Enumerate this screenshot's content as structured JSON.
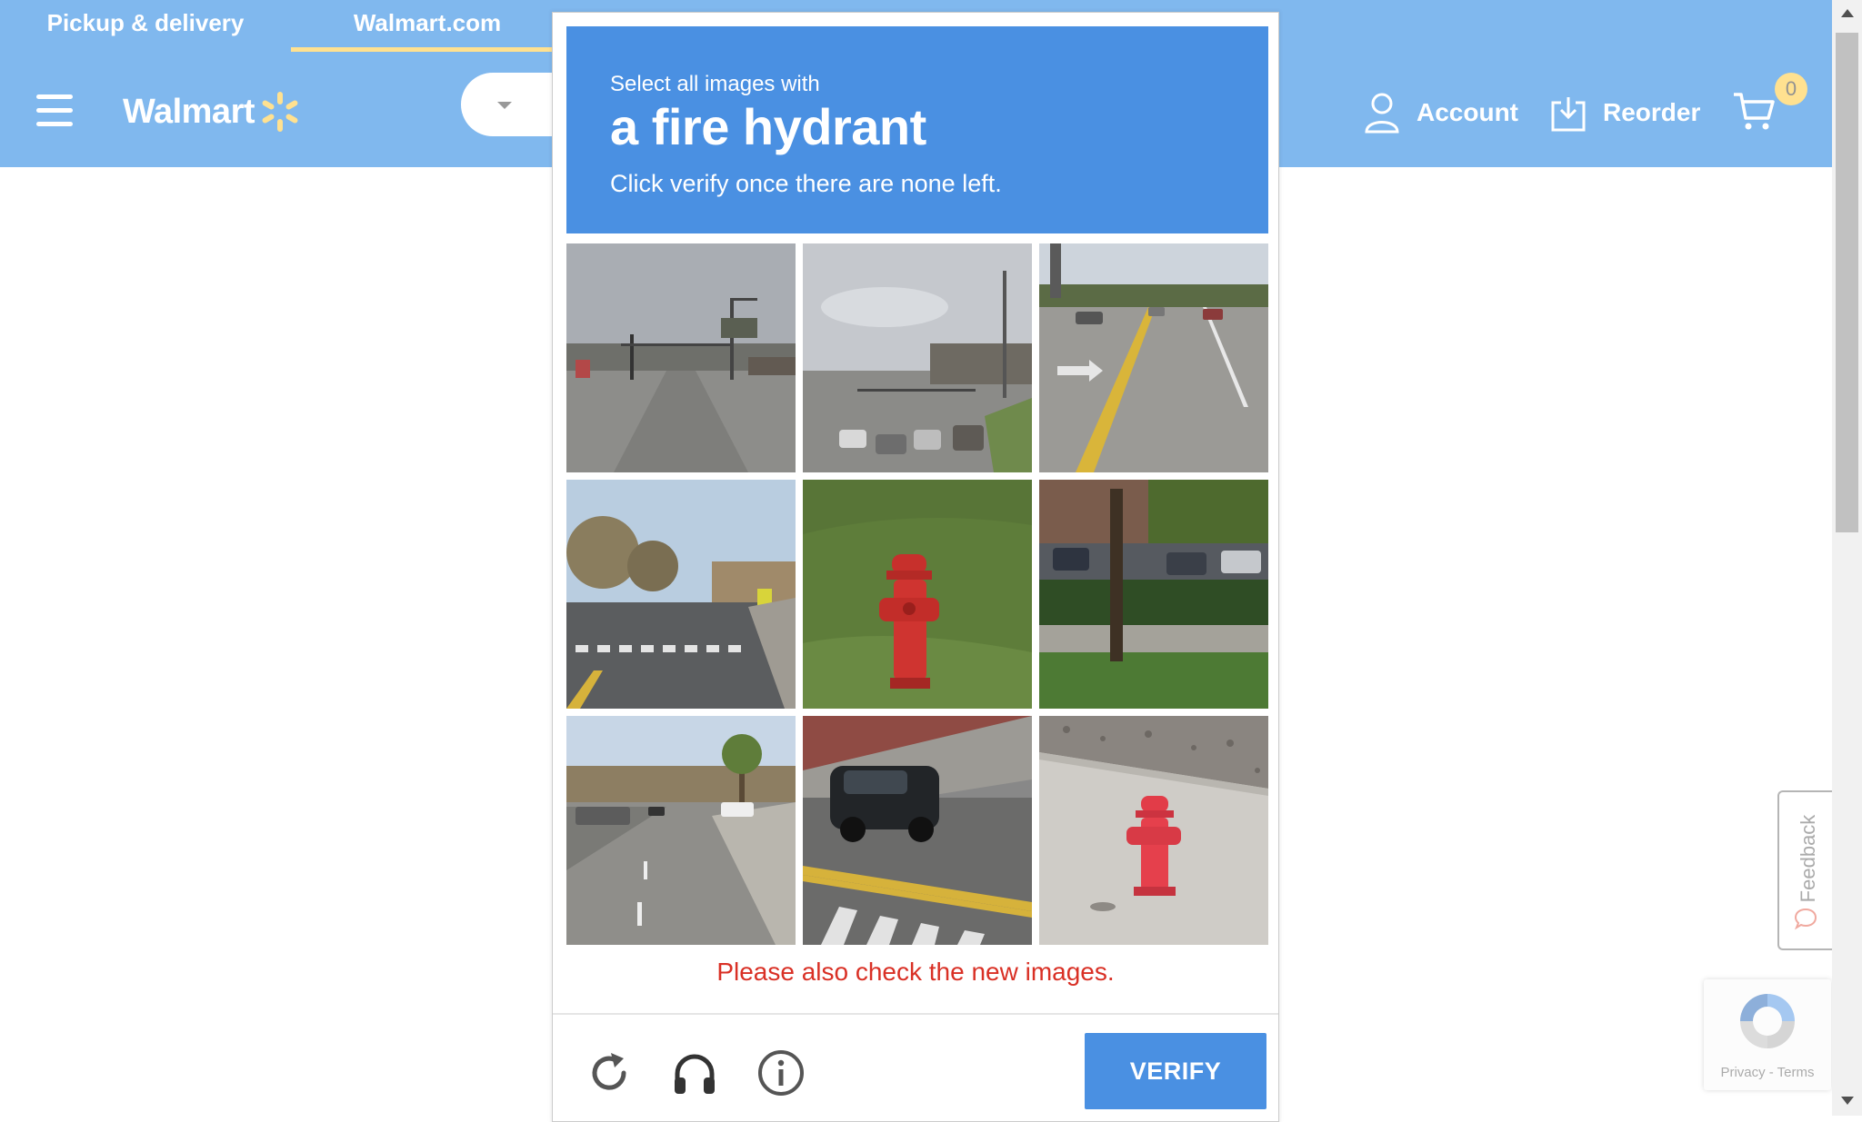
{
  "site": {
    "tabs": [
      "Pickup & delivery",
      "Walmart.com"
    ],
    "logo_text": "Walmart",
    "account_label": "Account",
    "reorder_label": "Reorder",
    "cart_count": "0",
    "feedback_label": "Feedback",
    "recaptcha_links": "Privacy - Terms",
    "brand_color": "#0071dc",
    "accent_color": "#ffc220"
  },
  "captcha": {
    "prompt_small": "Select all images with",
    "prompt_target": "a fire hydrant",
    "prompt_instruction": "Click verify once there are none left.",
    "error_message": "Please also check the new images.",
    "verify_label": "VERIFY",
    "header_color": "#4a90e2",
    "error_color": "#d93025",
    "tiles": [
      {
        "scene": "street-intersection-traffic-lights"
      },
      {
        "scene": "highway-traffic-cars"
      },
      {
        "scene": "highway-road-lanes"
      },
      {
        "scene": "street-crosswalk-trees"
      },
      {
        "scene": "fire-hydrant-on-grass"
      },
      {
        "scene": "tree-parking-lot-hedge"
      },
      {
        "scene": "wide-street-palm-trees"
      },
      {
        "scene": "car-on-road-markings"
      },
      {
        "scene": "fire-hydrant-on-sidewalk"
      }
    ],
    "tools": [
      "reload-icon",
      "headphones-icon",
      "info-icon"
    ]
  }
}
